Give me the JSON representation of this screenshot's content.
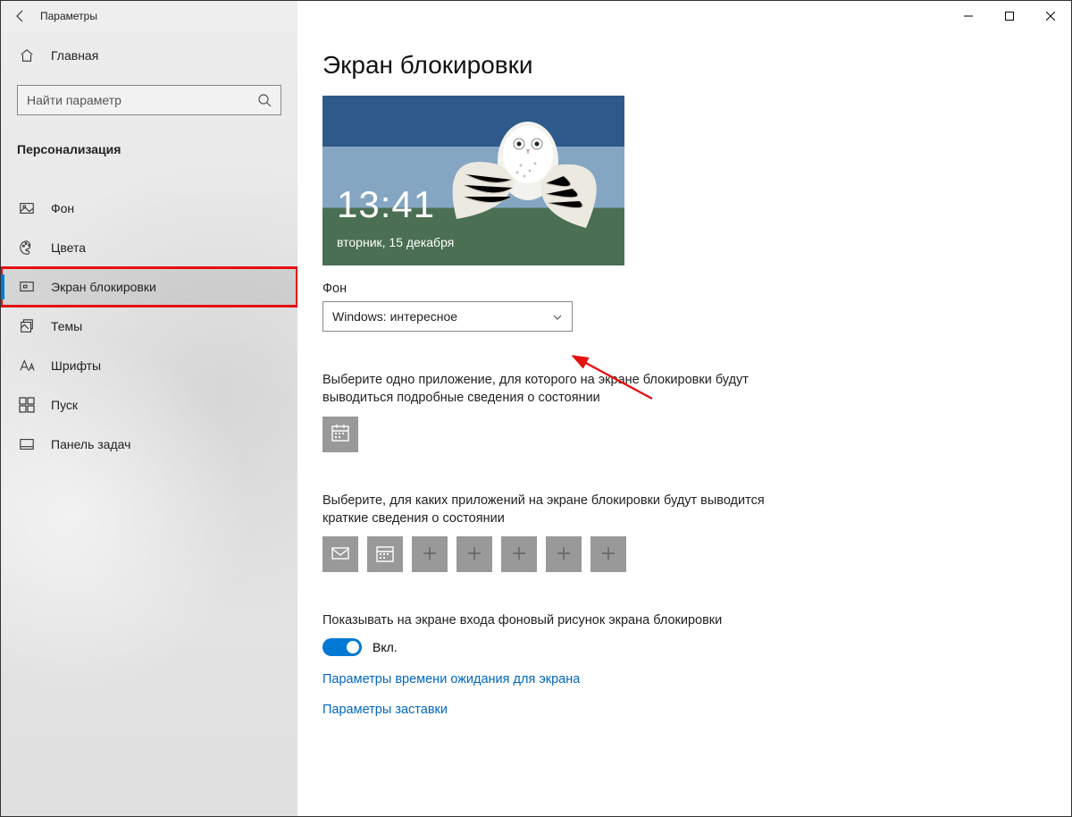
{
  "window": {
    "title": "Параметры"
  },
  "sidebar": {
    "home": "Главная",
    "search_placeholder": "Найти параметр",
    "category": "Персонализация",
    "items": [
      {
        "label": "Фон",
        "icon": "picture"
      },
      {
        "label": "Цвета",
        "icon": "palette"
      },
      {
        "label": "Экран блокировки",
        "icon": "lockscreen",
        "active": true,
        "highlighted": true
      },
      {
        "label": "Темы",
        "icon": "themes"
      },
      {
        "label": "Шрифты",
        "icon": "fonts"
      },
      {
        "label": "Пуск",
        "icon": "start"
      },
      {
        "label": "Панель задач",
        "icon": "taskbar"
      }
    ]
  },
  "page": {
    "title": "Экран блокировки",
    "preview": {
      "time": "13:41",
      "date": "вторник, 15 декабря"
    },
    "background_label": "Фон",
    "background_value": "Windows: интересное",
    "detailed_status_label": "Выберите одно приложение, для которого на экране блокировки будут выводиться подробные сведения о состоянии",
    "quick_status_label": "Выберите, для каких приложений на экране блокировки будут выводится краткие сведения о состоянии",
    "signin_background_label": "Показывать на экране входа фоновый рисунок экрана блокировки",
    "toggle_state": "Вкл.",
    "link_timeout": "Параметры времени ожидания для экрана",
    "link_screensaver": "Параметры заставки"
  }
}
